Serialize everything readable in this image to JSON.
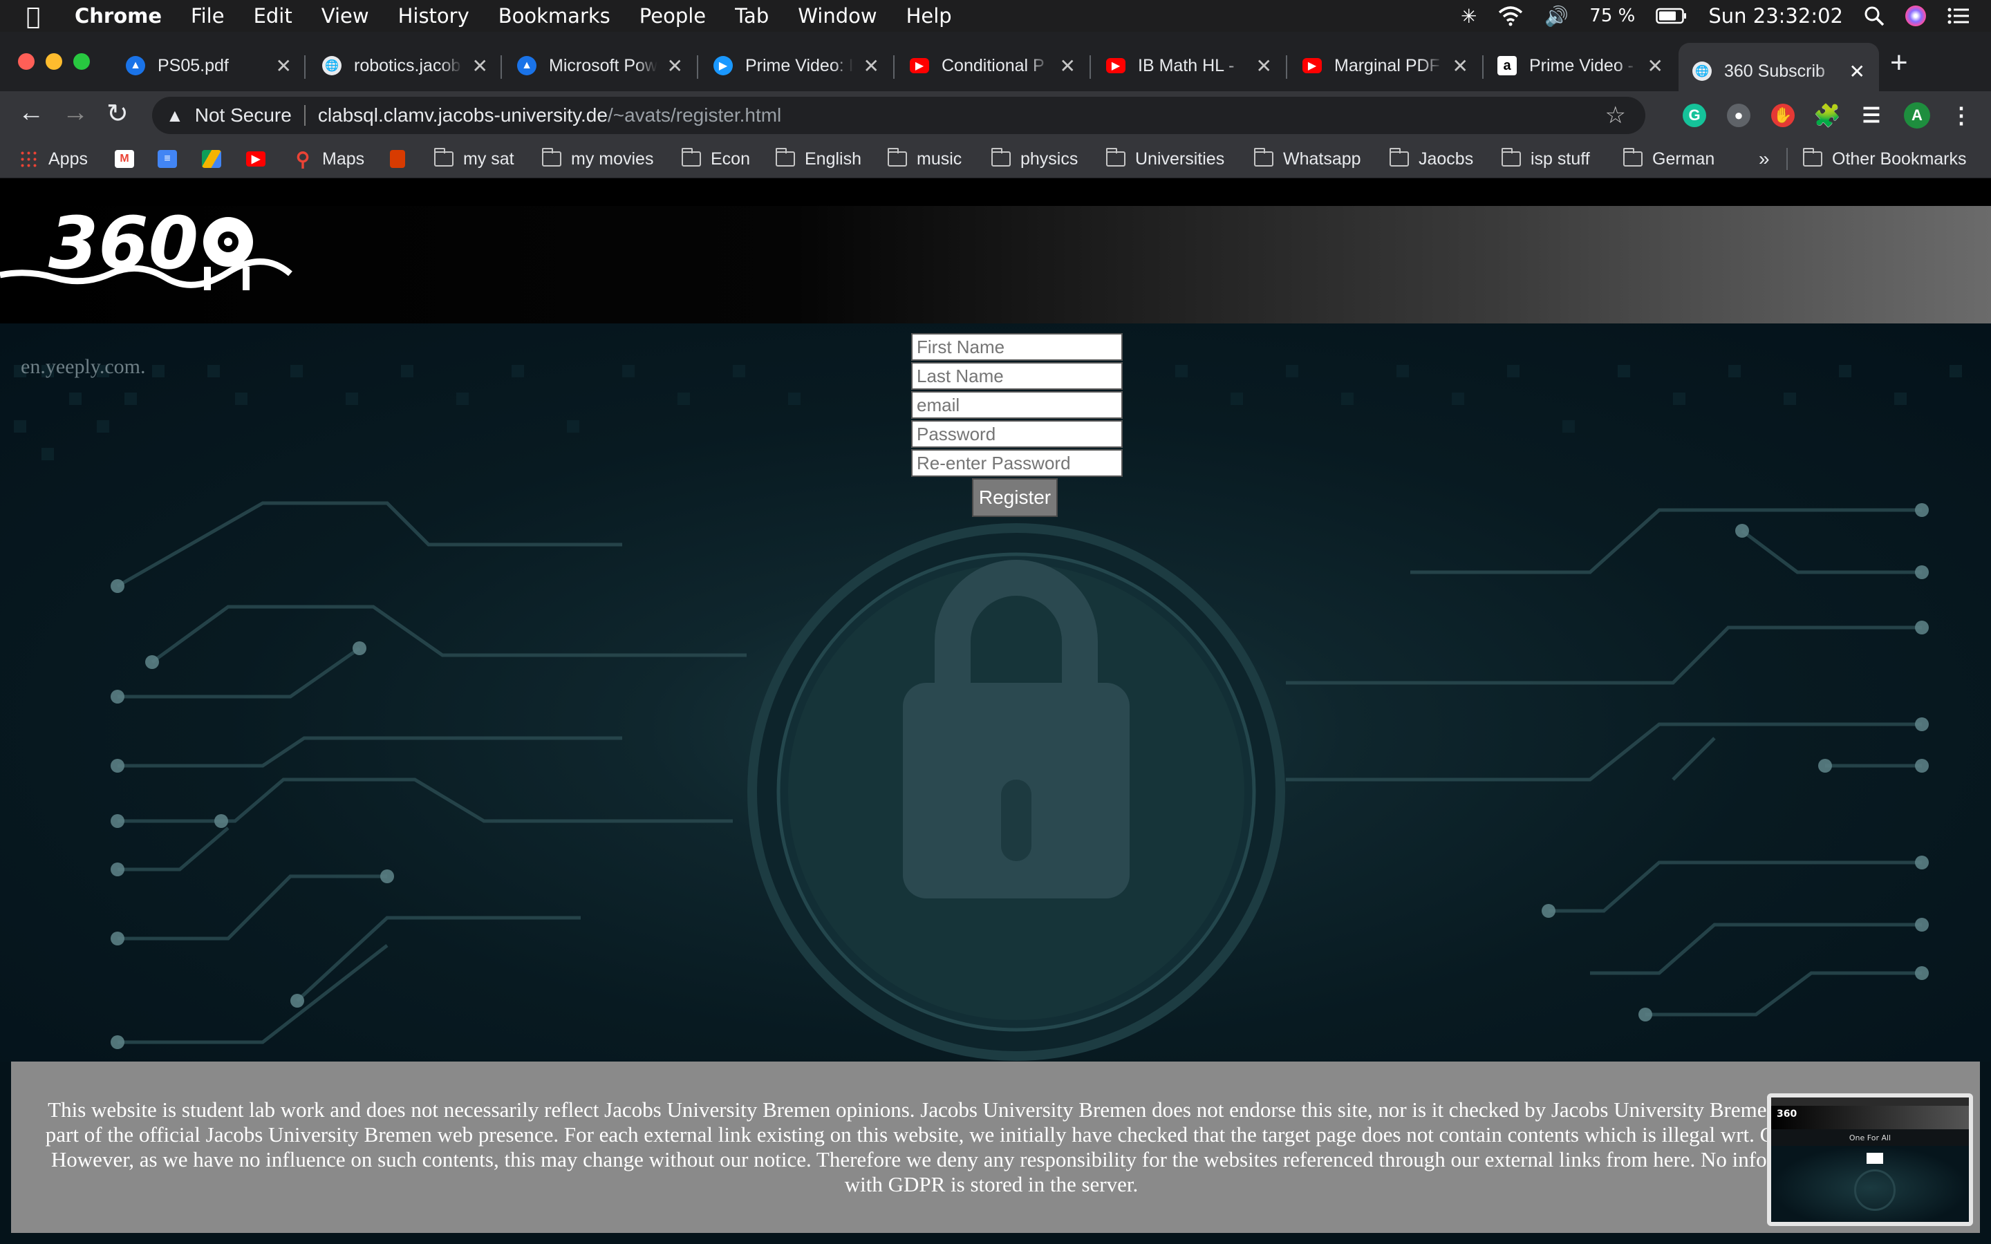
{
  "menubar": {
    "app": "Chrome",
    "menus": [
      "File",
      "Edit",
      "View",
      "History",
      "Bookmarks",
      "People",
      "Tab",
      "Window",
      "Help"
    ],
    "battery": "75 %",
    "clock": "Sun 23:32:02"
  },
  "tabs": [
    {
      "title": "PS05.pdf",
      "icon": "drive-icon",
      "color": "#1a73e8"
    },
    {
      "title": "robotics.jacob",
      "icon": "globe-icon",
      "color": "#9aa0a6"
    },
    {
      "title": "Microsoft Pow",
      "icon": "drive-icon",
      "color": "#1a73e8"
    },
    {
      "title": "Prime Video: I",
      "icon": "prime-icon",
      "color": "#1a98ff"
    },
    {
      "title": "Conditional P",
      "icon": "youtube-icon",
      "color": "#ff0000"
    },
    {
      "title": "IB Math HL - ",
      "icon": "youtube-icon",
      "color": "#ff0000"
    },
    {
      "title": "Marginal PDF",
      "icon": "youtube-icon",
      "color": "#ff0000"
    },
    {
      "title": "Prime Video -",
      "icon": "amazon-icon",
      "color": "#ffffff"
    },
    {
      "title": "360 Subscrib",
      "icon": "globe-icon",
      "color": "#9aa0a6"
    }
  ],
  "omnibox": {
    "security": "Not Secure",
    "host": "clabsql.clamv.jacobs-university.de",
    "path": "/~avats/register.html"
  },
  "bookmarks": [
    {
      "label": "Apps",
      "icon": "apps-icon"
    },
    {
      "label": "",
      "icon": "gmail-icon"
    },
    {
      "label": "",
      "icon": "docs-icon"
    },
    {
      "label": "",
      "icon": "drive-icon"
    },
    {
      "label": "",
      "icon": "youtube-icon"
    },
    {
      "label": "Maps",
      "icon": "maps-icon"
    },
    {
      "label": "",
      "icon": "office-icon"
    },
    {
      "label": "my sat",
      "icon": "folder-icon"
    },
    {
      "label": "my movies",
      "icon": "folder-icon"
    },
    {
      "label": "Econ",
      "icon": "folder-icon"
    },
    {
      "label": "English",
      "icon": "folder-icon"
    },
    {
      "label": "music",
      "icon": "folder-icon"
    },
    {
      "label": "physics",
      "icon": "folder-icon"
    },
    {
      "label": "Universities",
      "icon": "folder-icon"
    },
    {
      "label": "Whatsapp",
      "icon": "folder-icon"
    },
    {
      "label": "Jaocbs",
      "icon": "folder-icon"
    },
    {
      "label": "isp stuff",
      "icon": "folder-icon"
    },
    {
      "label": "German",
      "icon": "folder-icon"
    }
  ],
  "bookmarks_more": "»",
  "other_bookmarks": "Other Bookmarks",
  "profile_initial": "A",
  "page": {
    "logo_text": "360",
    "watermark": "en.yeeply.com.",
    "form": {
      "first_name": "First Name",
      "last_name": "Last Name",
      "email": "email",
      "password": "Password",
      "reenter_password": "Re-enter Password",
      "submit": "Register"
    },
    "footer_text": "This website is student lab work and does not necessarily reflect Jacobs University Bremen opinions. Jacobs University Bremen does not endorse this site, nor is it checked by Jacobs University Bremen regularly, nor is it part of the official Jacobs University Bremen web presence. For each external link existing on this website, we initially have checked that the target page does not contain contents which is illegal wrt. German jurisdiction. However, as we have no influence on such contents, this may change without our notice. Therefore we deny any responsibility for the websites referenced through our external links from here. No information conflicting with GDPR is stored in the server.",
    "thumbnail_title": "One For All"
  }
}
